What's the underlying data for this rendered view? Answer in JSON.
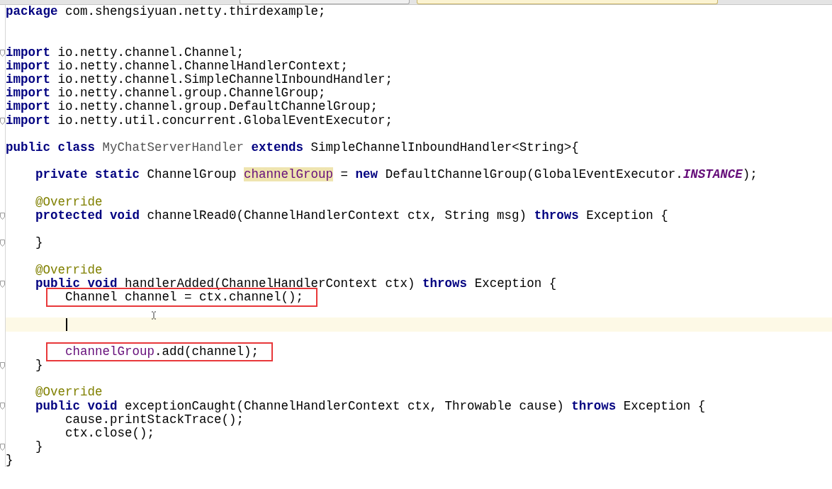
{
  "tabs": [
    {
      "selected": false
    },
    {
      "selected": true
    }
  ],
  "lines": [
    {
      "tokens": [
        {
          "text": "package",
          "kind": "keyword"
        },
        {
          "text": " com.shengsiyuan.netty.thirdexample;",
          "kind": "plain"
        }
      ],
      "current": false,
      "boxed": false,
      "fold": false
    },
    {
      "current": false,
      "boxed": false,
      "fold": false
    },
    {
      "current": false,
      "boxed": false,
      "fold": false
    },
    {
      "tokens": [
        {
          "text": "import",
          "kind": "keyword"
        },
        {
          "text": " io.netty.channel.Channel;",
          "kind": "plain"
        }
      ],
      "current": false,
      "boxed": false,
      "fold": true
    },
    {
      "tokens": [
        {
          "text": "import",
          "kind": "keyword"
        },
        {
          "text": " io.netty.channel.ChannelHandlerContext;",
          "kind": "plain"
        }
      ],
      "current": false,
      "boxed": false,
      "fold": false
    },
    {
      "tokens": [
        {
          "text": "import",
          "kind": "keyword"
        },
        {
          "text": " io.netty.channel.SimpleChannelInboundHandler;",
          "kind": "plain"
        }
      ],
      "current": false,
      "boxed": false,
      "fold": false
    },
    {
      "tokens": [
        {
          "text": "import",
          "kind": "keyword"
        },
        {
          "text": " io.netty.channel.group.ChannelGroup;",
          "kind": "plain"
        }
      ],
      "current": false,
      "boxed": false,
      "fold": false
    },
    {
      "tokens": [
        {
          "text": "import",
          "kind": "keyword"
        },
        {
          "text": " io.netty.channel.group.DefaultChannelGroup;",
          "kind": "plain"
        }
      ],
      "current": false,
      "boxed": false,
      "fold": false
    },
    {
      "tokens": [
        {
          "text": "import",
          "kind": "keyword"
        },
        {
          "text": " io.netty.util.concurrent.GlobalEventExecutor;",
          "kind": "plain"
        }
      ],
      "current": false,
      "boxed": false,
      "fold": true
    },
    {
      "current": false,
      "boxed": false,
      "fold": false
    },
    {
      "tokens": [
        {
          "text": "public class ",
          "kind": "keyword"
        },
        {
          "text": "MyChatServerHandler ",
          "kind": "class-decl"
        },
        {
          "text": "extends",
          "kind": "keyword"
        },
        {
          "text": " SimpleChannelInboundHandler<String>{",
          "kind": "plain"
        }
      ],
      "current": false,
      "boxed": false,
      "fold": false
    },
    {
      "current": false,
      "boxed": false,
      "fold": false
    },
    {
      "tokens": [
        {
          "text": "    private static",
          "kind": "keyword"
        },
        {
          "text": " ChannelGroup ",
          "kind": "plain"
        },
        {
          "text": "channelGroup",
          "kind": "usage-highlight"
        },
        {
          "text": " = ",
          "kind": "plain"
        },
        {
          "text": "new",
          "kind": "keyword"
        },
        {
          "text": " DefaultChannelGroup(GlobalEventExecutor.",
          "kind": "plain"
        },
        {
          "text": "INSTANCE",
          "kind": "static-field"
        },
        {
          "text": ");",
          "kind": "plain"
        }
      ],
      "current": false,
      "boxed": false,
      "fold": false
    },
    {
      "current": false,
      "boxed": false,
      "fold": false
    },
    {
      "tokens": [
        {
          "text": "    @Override",
          "kind": "annotation"
        }
      ],
      "current": false,
      "boxed": false,
      "fold": false
    },
    {
      "tokens": [
        {
          "text": "    protected void",
          "kind": "keyword"
        },
        {
          "text": " channelRead0(ChannelHandlerContext ctx, String msg) ",
          "kind": "plain"
        },
        {
          "text": "throws",
          "kind": "keyword"
        },
        {
          "text": " Exception {",
          "kind": "plain"
        }
      ],
      "current": false,
      "boxed": false,
      "fold": true
    },
    {
      "current": false,
      "boxed": false,
      "fold": false
    },
    {
      "tokens": [
        {
          "text": "    }",
          "kind": "plain"
        }
      ],
      "current": false,
      "boxed": false,
      "fold": true
    },
    {
      "current": false,
      "boxed": false,
      "fold": false
    },
    {
      "tokens": [
        {
          "text": "    @Override",
          "kind": "annotation"
        }
      ],
      "current": false,
      "boxed": false,
      "fold": false
    },
    {
      "tokens": [
        {
          "text": "    public void",
          "kind": "keyword"
        },
        {
          "text": " handlerAdded(ChannelHandlerContext ctx) ",
          "kind": "plain"
        },
        {
          "text": "throws",
          "kind": "keyword"
        },
        {
          "text": " Exception {",
          "kind": "plain"
        }
      ],
      "current": false,
      "boxed": false,
      "fold": true
    },
    {
      "tokens": [
        {
          "text": "        Channel channel = ctx.channel();",
          "kind": "plain"
        }
      ],
      "current": false,
      "boxed": true,
      "fold": false
    },
    {
      "current": false,
      "boxed": false,
      "fold": false
    },
    {
      "current": true,
      "boxed": false,
      "fold": false
    },
    {
      "current": false,
      "boxed": false,
      "fold": false
    },
    {
      "tokens": [
        {
          "text": "        channelGroup",
          "kind": "field"
        },
        {
          "text": ".add(channel);",
          "kind": "plain"
        }
      ],
      "current": false,
      "boxed": true,
      "fold": false
    },
    {
      "tokens": [
        {
          "text": "    }",
          "kind": "plain"
        }
      ],
      "current": false,
      "boxed": false,
      "fold": true
    },
    {
      "current": false,
      "boxed": false,
      "fold": false
    },
    {
      "tokens": [
        {
          "text": "    @Override",
          "kind": "annotation"
        }
      ],
      "current": false,
      "boxed": false,
      "fold": false
    },
    {
      "tokens": [
        {
          "text": "    public void",
          "kind": "keyword"
        },
        {
          "text": " exceptionCaught(ChannelHandlerContext ctx, Throwable cause) ",
          "kind": "plain"
        },
        {
          "text": "throws",
          "kind": "keyword"
        },
        {
          "text": " Exception {",
          "kind": "plain"
        }
      ],
      "current": false,
      "boxed": false,
      "fold": true
    },
    {
      "tokens": [
        {
          "text": "        cause.printStackTrace();",
          "kind": "plain"
        }
      ],
      "current": false,
      "boxed": false,
      "fold": false
    },
    {
      "tokens": [
        {
          "text": "        ctx.close();",
          "kind": "plain"
        }
      ],
      "current": false,
      "boxed": false,
      "fold": false
    },
    {
      "tokens": [
        {
          "text": "    }",
          "kind": "plain"
        }
      ],
      "current": false,
      "boxed": false,
      "fold": true
    },
    {
      "tokens": [
        {
          "text": "}",
          "kind": "plain"
        }
      ],
      "current": false,
      "boxed": false,
      "fold": false
    }
  ]
}
